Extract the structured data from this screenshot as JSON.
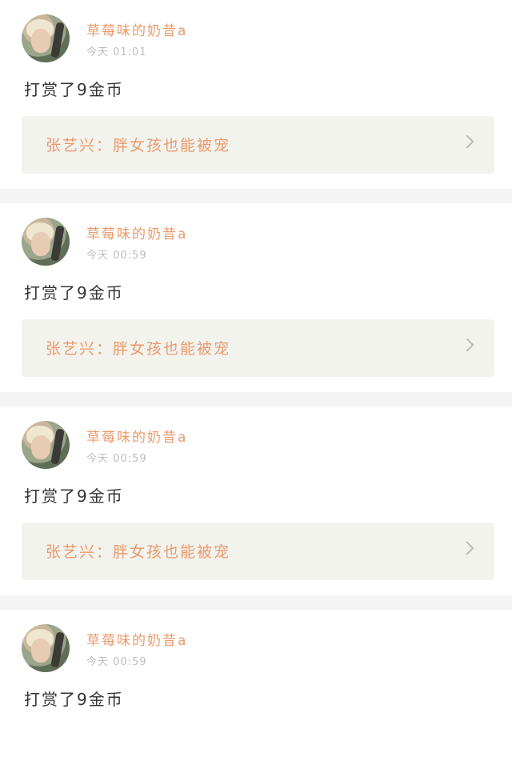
{
  "posts": [
    {
      "username": "草莓味的奶昔a",
      "time": "今天 01:01",
      "action": "打赏了9金币",
      "link_text": "张艺兴：胖女孩也能被宠"
    },
    {
      "username": "草莓味的奶昔a",
      "time": "今天 00:59",
      "action": "打赏了9金币",
      "link_text": "张艺兴：胖女孩也能被宠"
    },
    {
      "username": "草莓味的奶昔a",
      "time": "今天 00:59",
      "action": "打赏了9金币",
      "link_text": "张艺兴：胖女孩也能被宠"
    },
    {
      "username": "草莓味的奶昔a",
      "time": "今天 00:59",
      "action": "打赏了9金币"
    }
  ],
  "colors": {
    "accent": "#e99a6c",
    "time": "#bdbdbd",
    "text": "#333333",
    "link_bg": "#f3f3ee",
    "page_bg": "#f4f4f4"
  }
}
